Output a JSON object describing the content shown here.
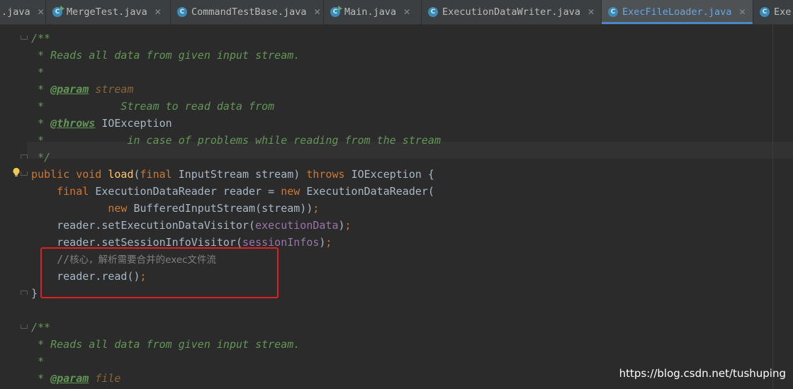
{
  "tabs": [
    {
      "label": ".java",
      "icon": "",
      "active": false
    },
    {
      "label": "MergeTest.java",
      "icon": "class-runnable-icon",
      "active": false
    },
    {
      "label": "CommandTestBase.java",
      "icon": "abstract-class-icon",
      "active": false
    },
    {
      "label": "Main.java",
      "icon": "class-runnable-icon",
      "active": false
    },
    {
      "label": "ExecutionDataWriter.java",
      "icon": "class-icon",
      "active": false
    },
    {
      "label": "ExecFileLoader.java",
      "icon": "class-icon",
      "active": true
    },
    {
      "label": "Exe",
      "icon": "class-icon",
      "active": false
    }
  ],
  "tab_close_glyph": "✕",
  "class_glyph": "C",
  "code_lines": [
    [
      {
        "t": "/**",
        "c": "doc"
      }
    ],
    [
      {
        "t": " * Reads all data from given input stream.",
        "c": "doc"
      }
    ],
    [
      {
        "t": " *",
        "c": "doc"
      }
    ],
    [
      {
        "t": " * ",
        "c": "doc"
      },
      {
        "t": "@param",
        "c": "tag"
      },
      {
        "t": " stream",
        "c": "param"
      }
    ],
    [
      {
        "t": " *            Stream to read data from",
        "c": "doc"
      }
    ],
    [
      {
        "t": " * ",
        "c": "doc"
      },
      {
        "t": "@throws",
        "c": "tag"
      },
      {
        "t": " IOException",
        "c": "txt"
      }
    ],
    [
      {
        "t": " *             in case of problems while reading from the stream",
        "c": "doc"
      }
    ],
    [
      {
        "t": " */",
        "c": "doc"
      }
    ],
    [
      {
        "t": "public void ",
        "c": "kw"
      },
      {
        "t": "load",
        "c": "fn"
      },
      {
        "t": "(",
        "c": "txt"
      },
      {
        "t": "final ",
        "c": "kw"
      },
      {
        "t": "InputStream stream) ",
        "c": "txt"
      },
      {
        "t": "throws ",
        "c": "kw"
      },
      {
        "t": "IOException {",
        "c": "txt"
      }
    ],
    [
      {
        "t": "    ",
        "c": "txt"
      },
      {
        "t": "final ",
        "c": "kw"
      },
      {
        "t": "ExecutionDataReader reader = ",
        "c": "txt"
      },
      {
        "t": "new ",
        "c": "kw"
      },
      {
        "t": "ExecutionDataReader(",
        "c": "txt"
      }
    ],
    [
      {
        "t": "            ",
        "c": "txt"
      },
      {
        "t": "new ",
        "c": "kw"
      },
      {
        "t": "BufferedInputStream(stream))",
        "c": "txt"
      },
      {
        "t": ";",
        "c": "kw"
      }
    ],
    [
      {
        "t": "    reader.setExecutionDataVisitor(",
        "c": "txt"
      },
      {
        "t": "executionData",
        "c": "field"
      },
      {
        "t": ")",
        "c": "txt"
      },
      {
        "t": ";",
        "c": "kw"
      }
    ],
    [
      {
        "t": "    reader.setSessionInfoVisitor(",
        "c": "txt"
      },
      {
        "t": "sessionInfos",
        "c": "field"
      },
      {
        "t": ")",
        "c": "txt"
      },
      {
        "t": ";",
        "c": "kw"
      }
    ],
    [
      {
        "t": "    ",
        "c": "txt"
      },
      {
        "t": "//",
        "c": "cmt"
      },
      {
        "t": "核心，解析需要合并的exec文件流",
        "c": "cn"
      }
    ],
    [
      {
        "t": "    reader.read()",
        "c": "txt"
      },
      {
        "t": ";",
        "c": "kw"
      }
    ],
    [
      {
        "t": "}",
        "c": "txt"
      }
    ],
    [],
    [
      {
        "t": "/**",
        "c": "doc"
      }
    ],
    [
      {
        "t": " * Reads all data from given input stream.",
        "c": "doc"
      }
    ],
    [
      {
        "t": " *",
        "c": "doc"
      }
    ],
    [
      {
        "t": " * ",
        "c": "doc"
      },
      {
        "t": "@param",
        "c": "tag"
      },
      {
        "t": " file",
        "c": "param"
      }
    ]
  ],
  "watermark": "https://blog.csdn.net/tushuping",
  "colors": {
    "background": "#2b2b2b",
    "keyword": "#cc7832",
    "doc_comment": "#629755",
    "method": "#ffc66d",
    "field": "#9876aa",
    "highlight_box": "#e02020",
    "active_tab_text": "#6aa6e0"
  }
}
